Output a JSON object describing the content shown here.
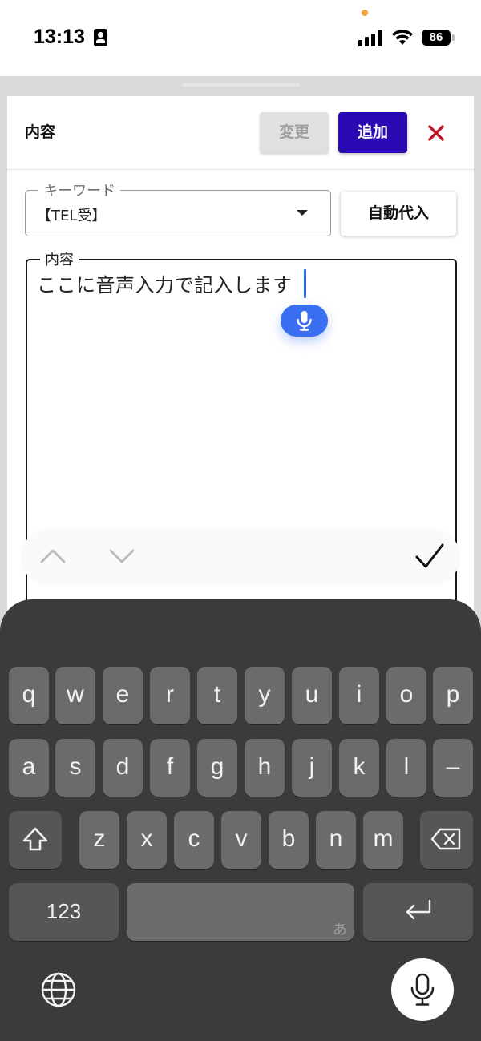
{
  "status_bar": {
    "time": "13:13",
    "battery": "86"
  },
  "header": {
    "title": "内容",
    "change_label": "変更",
    "add_label": "追加",
    "close_icon": "close-icon",
    "accent": "#2a0ab3",
    "close_color": "#c0142a"
  },
  "keyword_field": {
    "label": "キーワード",
    "value": "【TEL受】"
  },
  "auto_assign_label": "自動代入",
  "content_field": {
    "label": "内容",
    "value": "ここに音声入力で記入します"
  },
  "keyboard": {
    "row1": [
      "q",
      "w",
      "e",
      "r",
      "t",
      "y",
      "u",
      "i",
      "o",
      "p"
    ],
    "row2": [
      "a",
      "s",
      "d",
      "f",
      "g",
      "h",
      "j",
      "k",
      "l",
      "–"
    ],
    "row3": [
      "z",
      "x",
      "c",
      "v",
      "b",
      "n",
      "m"
    ],
    "numbers_label": "123",
    "space_sub": "あ"
  }
}
